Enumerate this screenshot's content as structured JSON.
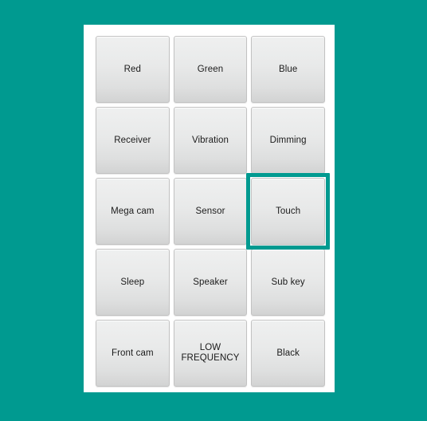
{
  "theme": {
    "background_color": "#009A90",
    "panel_color": "#FFFFFF",
    "button_color": "#E6E7E7",
    "button_border_color": "#C2C2C2",
    "text_color": "#1B1B1B",
    "highlight_color": "#009A90"
  },
  "grid": {
    "columns": 3,
    "rows": 5,
    "selected_index": 8,
    "buttons": [
      {
        "label": "Red",
        "selected": false
      },
      {
        "label": "Green",
        "selected": false
      },
      {
        "label": "Blue",
        "selected": false
      },
      {
        "label": "Receiver",
        "selected": false
      },
      {
        "label": "Vibration",
        "selected": false
      },
      {
        "label": "Dimming",
        "selected": false
      },
      {
        "label": "Mega cam",
        "selected": false
      },
      {
        "label": "Sensor",
        "selected": false
      },
      {
        "label": "Touch",
        "selected": true
      },
      {
        "label": "Sleep",
        "selected": false
      },
      {
        "label": "Speaker",
        "selected": false
      },
      {
        "label": "Sub key",
        "selected": false
      },
      {
        "label": "Front cam",
        "selected": false
      },
      {
        "label": "LOW\nFREQUENCY",
        "selected": false
      },
      {
        "label": "Black",
        "selected": false
      }
    ]
  }
}
